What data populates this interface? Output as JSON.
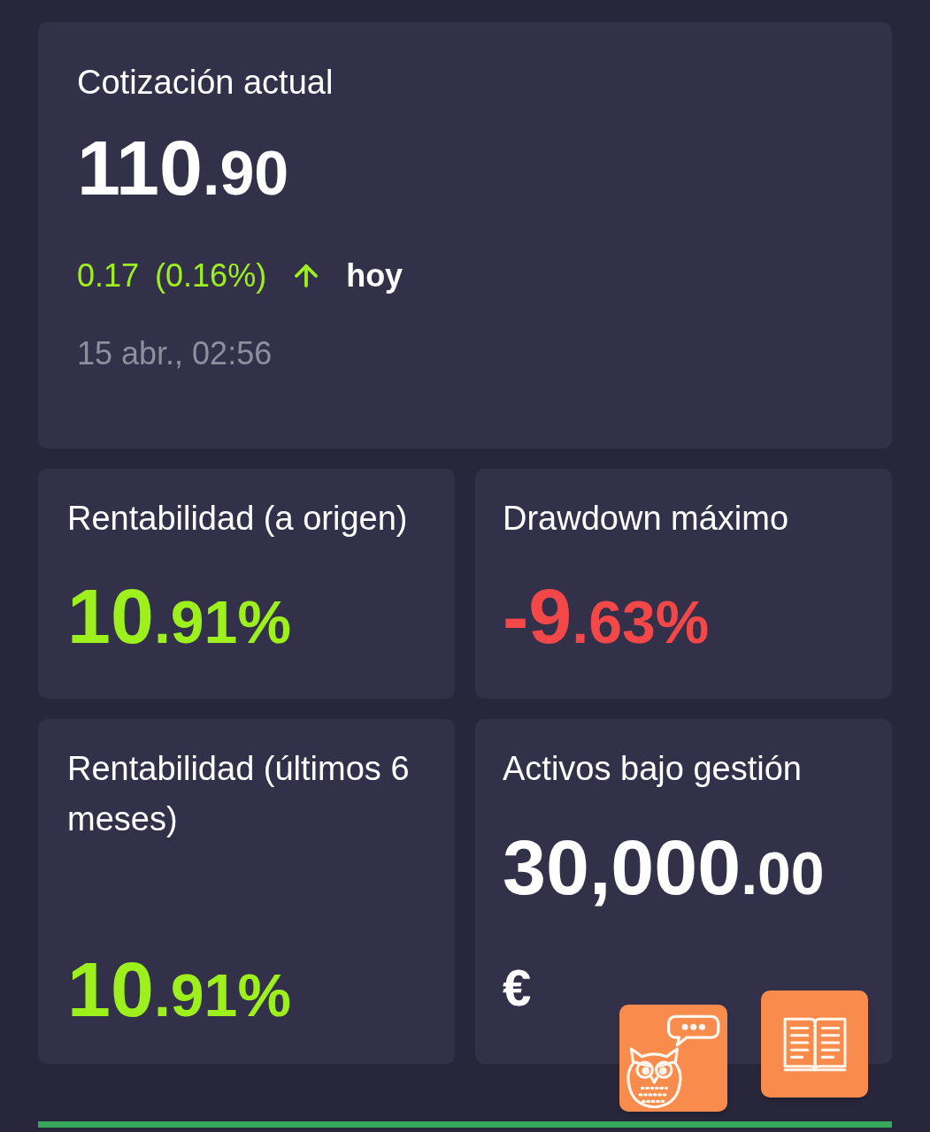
{
  "price_card": {
    "title": "Cotización actual",
    "value": {
      "whole": "110",
      "fraction": ".90"
    },
    "change": {
      "amount": "0.17",
      "percent": "(0.16%)",
      "rising": true,
      "period": "hoy"
    },
    "timestamp": "15 abr., 02:56"
  },
  "metrics": [
    {
      "title": "Rentabilidad (a origen)",
      "color": "#9ef01c",
      "value": {
        "whole": "10",
        "fraction": ".91%"
      }
    },
    {
      "title": "Drawdown máximo",
      "color": "#f44848",
      "value": {
        "whole": "-9",
        "fraction": ".63%"
      }
    },
    {
      "title": "Rentabilidad (últimos 6 meses)",
      "color": "#9ef01c",
      "value": {
        "whole": "10",
        "fraction": ".91%"
      }
    },
    {
      "title": "Activos bajo gestión",
      "color": "#ffffff",
      "value": {
        "whole": "30,000",
        "fraction": ".00"
      },
      "unit": "€"
    }
  ],
  "floating_buttons": [
    {
      "kind": "owl_chat"
    },
    {
      "kind": "book"
    }
  ]
}
